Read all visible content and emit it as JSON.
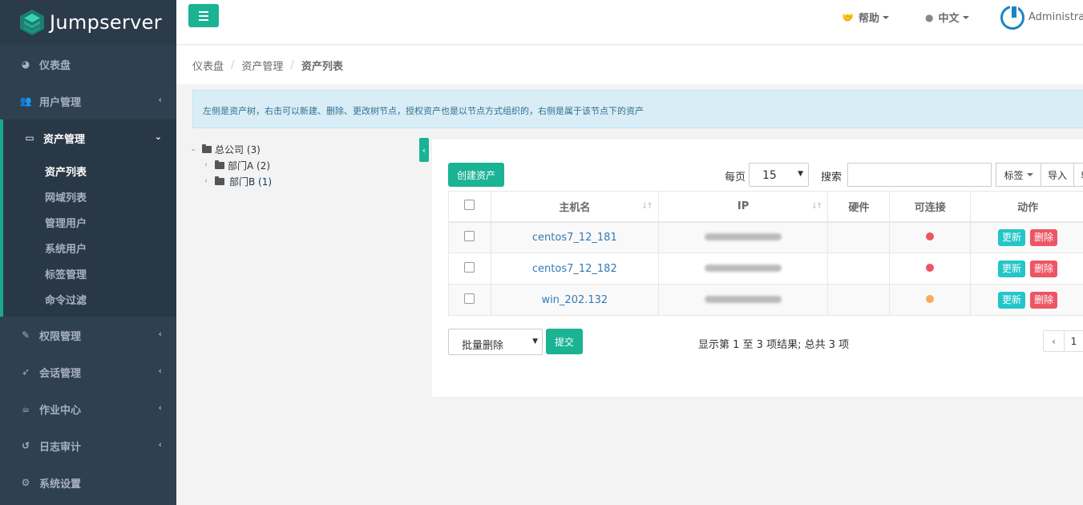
{
  "brand": {
    "name": "Jumpserver"
  },
  "sidebar": {
    "items": [
      {
        "label": "仪表盘",
        "icon": "dashboard-icon"
      },
      {
        "label": "用户管理",
        "icon": "users-icon"
      },
      {
        "label": "资产管理",
        "icon": "inbox-icon",
        "active": true
      },
      {
        "label": "权限管理",
        "icon": "edit-icon"
      },
      {
        "label": "会话管理",
        "icon": "rocket-icon"
      },
      {
        "label": "作业中心",
        "icon": "coffee-icon"
      },
      {
        "label": "日志审计",
        "icon": "history-icon"
      },
      {
        "label": "系统设置",
        "icon": "gears-icon"
      }
    ],
    "subitems": [
      "资产列表",
      "网域列表",
      "管理用户",
      "系统用户",
      "标签管理",
      "命令过滤"
    ]
  },
  "topbar": {
    "help": "帮助",
    "language": "中文",
    "user": "Administrator"
  },
  "breadcrumb": [
    "仪表盘",
    "资产管理",
    "资产列表"
  ],
  "alert": "左侧是资产树，右击可以新建、删除、更改树节点，授权资产也是以节点方式组织的，右侧是属于该节点下的资产",
  "tree": {
    "root": "总公司 (3)",
    "children": [
      "部门A (2)",
      "部门B (1)"
    ]
  },
  "toolbar": {
    "create": "创建资产",
    "per_page_label": "每页",
    "per_page_value": "15",
    "search_label": "搜索",
    "search_value": "",
    "tag": "标签",
    "import": "导入",
    "export": "导出"
  },
  "table": {
    "headers": [
      "主机名",
      "IP",
      "硬件",
      "可连接",
      "动作"
    ],
    "rows": [
      {
        "hostname": "centos7_12_181",
        "status_color": "#ed5565"
      },
      {
        "hostname": "centos7_12_182",
        "status_color": "#ed5565"
      },
      {
        "hostname": "win_202.132",
        "status_color": "#f8ac59"
      }
    ],
    "update_label": "更新",
    "delete_label": "删除"
  },
  "footer": {
    "bulk_action": "批量删除",
    "submit": "提交",
    "info": "显示第 1 至 3 项结果; 总共 3 项",
    "prev": "‹",
    "page": "1"
  },
  "colors": {
    "primary": "#1ab394",
    "sidebar": "#2f4050",
    "info": "#23c6c8",
    "danger": "#ed5565",
    "warning": "#f8ac59"
  }
}
